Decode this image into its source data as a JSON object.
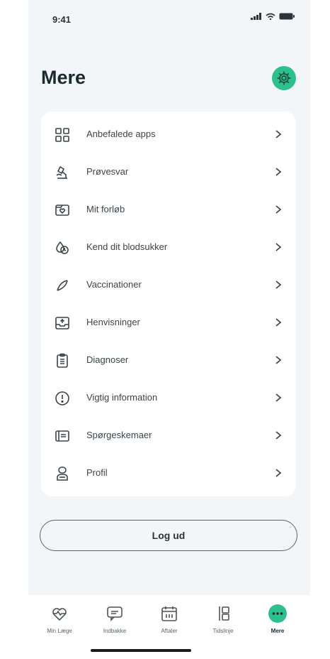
{
  "status_bar": {
    "time": "9:41"
  },
  "header": {
    "title": "Mere"
  },
  "menu": {
    "items": [
      {
        "label": "Anbefalede apps",
        "icon": "grid-apps-icon"
      },
      {
        "label": "Prøvesvar",
        "icon": "microscope-icon"
      },
      {
        "label": "Mit forløb",
        "icon": "heart-folder-icon"
      },
      {
        "label": "Kend dit blodsukker",
        "icon": "blood-sugar-icon"
      },
      {
        "label": "Vaccinationer",
        "icon": "vaccine-icon"
      },
      {
        "label": "Henvisninger",
        "icon": "inbox-referral-icon"
      },
      {
        "label": "Diagnoser",
        "icon": "clipboard-icon"
      },
      {
        "label": "Vigtig information",
        "icon": "exclamation-circle-icon"
      },
      {
        "label": "Spørgeskemaer",
        "icon": "form-icon"
      },
      {
        "label": "Profil",
        "icon": "profile-icon"
      }
    ]
  },
  "logout": {
    "label": "Log ud"
  },
  "tabs": [
    {
      "label": "Min Læge",
      "icon": "heart-pulse-icon"
    },
    {
      "label": "Indbakke",
      "icon": "message-icon"
    },
    {
      "label": "Aftaler",
      "icon": "calendar-icon"
    },
    {
      "label": "Tidslinje",
      "icon": "timeline-icon"
    },
    {
      "label": "Mere",
      "icon": "more-icon"
    }
  ],
  "colors": {
    "accent": "#2ebf8e",
    "background": "#f3f6f8",
    "card": "#ffffff",
    "text": "#1c2a30"
  }
}
